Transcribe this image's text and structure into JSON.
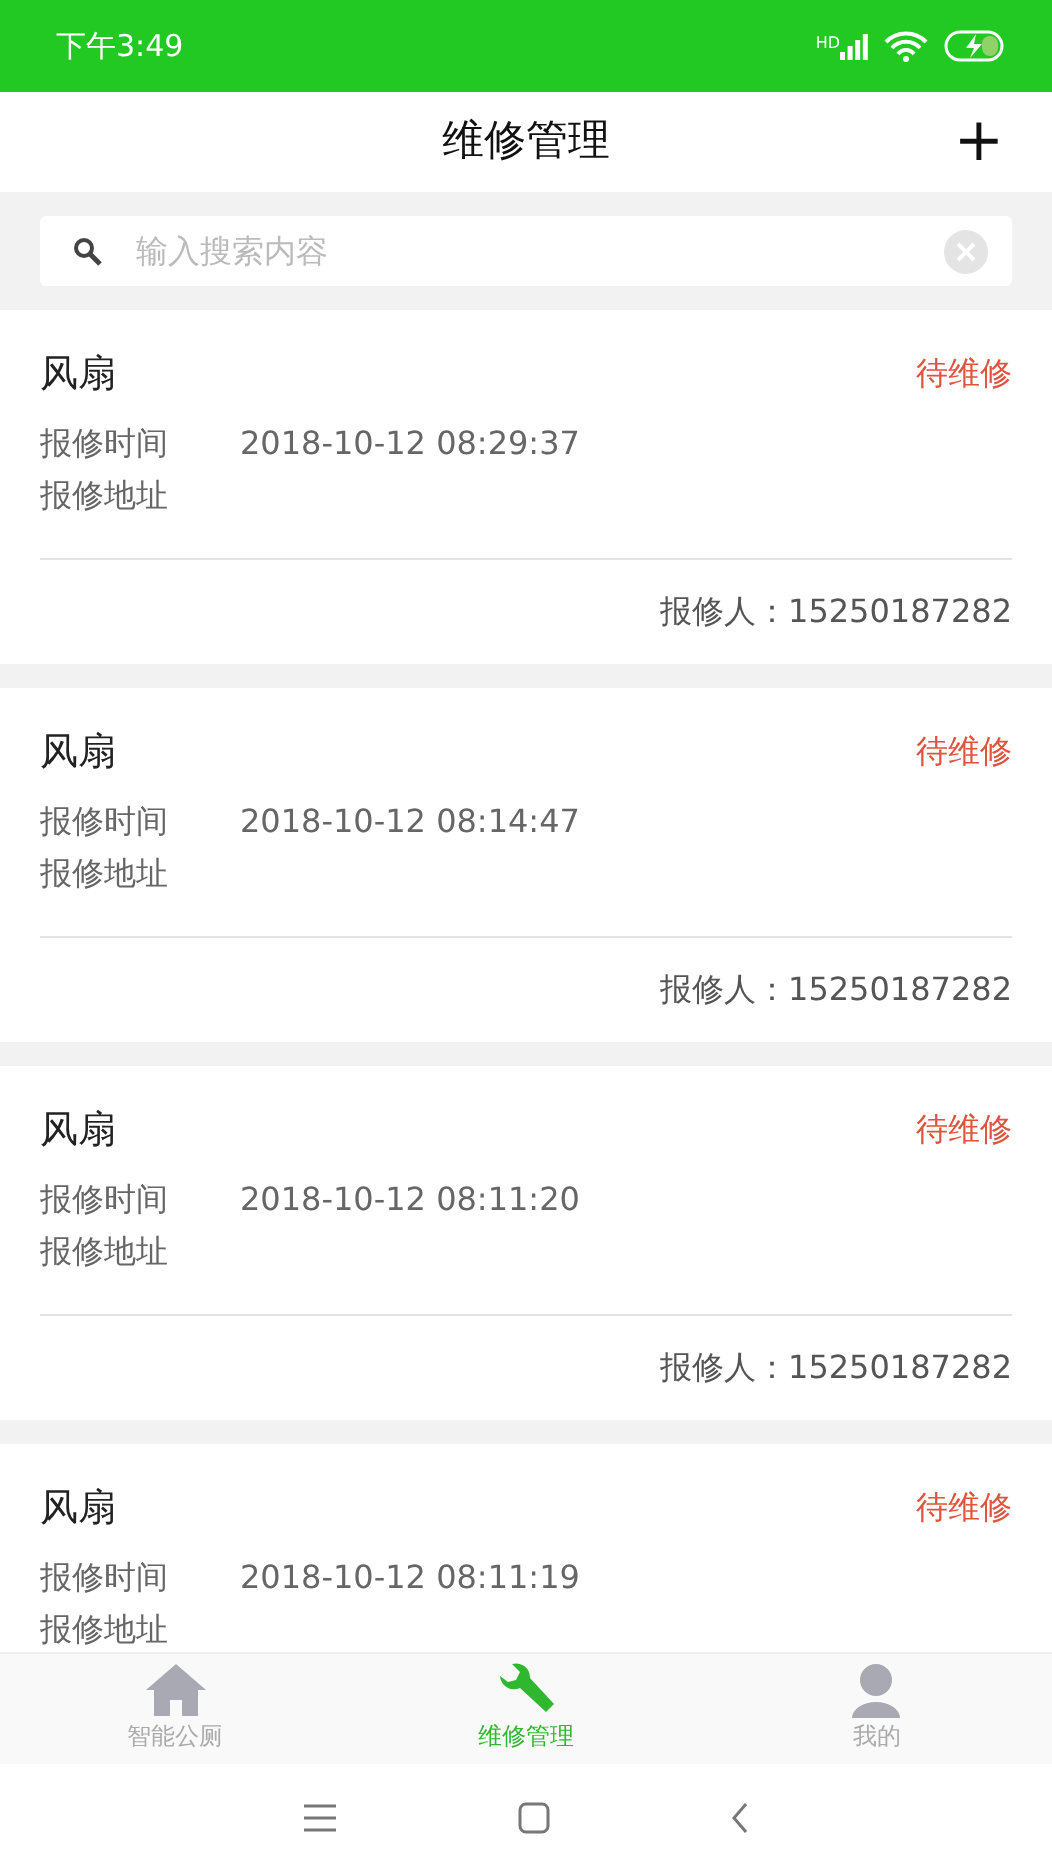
{
  "status_bar": {
    "time": "下午3:49",
    "signal_label": "HD"
  },
  "header": {
    "title": "维修管理",
    "add": "+"
  },
  "search": {
    "placeholder": "输入搜索内容"
  },
  "records": [
    {
      "title": "风扇",
      "status": "待维修",
      "time_label": "报修时间",
      "time": "2018-10-12 08:29:37",
      "address_label": "报修地址",
      "reporter": "报修人：15250187282"
    },
    {
      "title": "风扇",
      "status": "待维修",
      "time_label": "报修时间",
      "time": "2018-10-12 08:14:47",
      "address_label": "报修地址",
      "reporter": "报修人：15250187282"
    },
    {
      "title": "风扇",
      "status": "待维修",
      "time_label": "报修时间",
      "time": "2018-10-12 08:11:20",
      "address_label": "报修地址",
      "reporter": "报修人：15250187282"
    },
    {
      "title": "风扇",
      "status": "待维修",
      "time_label": "报修时间",
      "time": "2018-10-12 08:11:19",
      "address_label": "报修地址"
    }
  ],
  "tabs": [
    {
      "label": "智能公厕",
      "kind": "home",
      "selected": false
    },
    {
      "label": "维修管理",
      "kind": "wrench",
      "selected": true
    },
    {
      "label": "我的",
      "kind": "person",
      "selected": false
    }
  ]
}
